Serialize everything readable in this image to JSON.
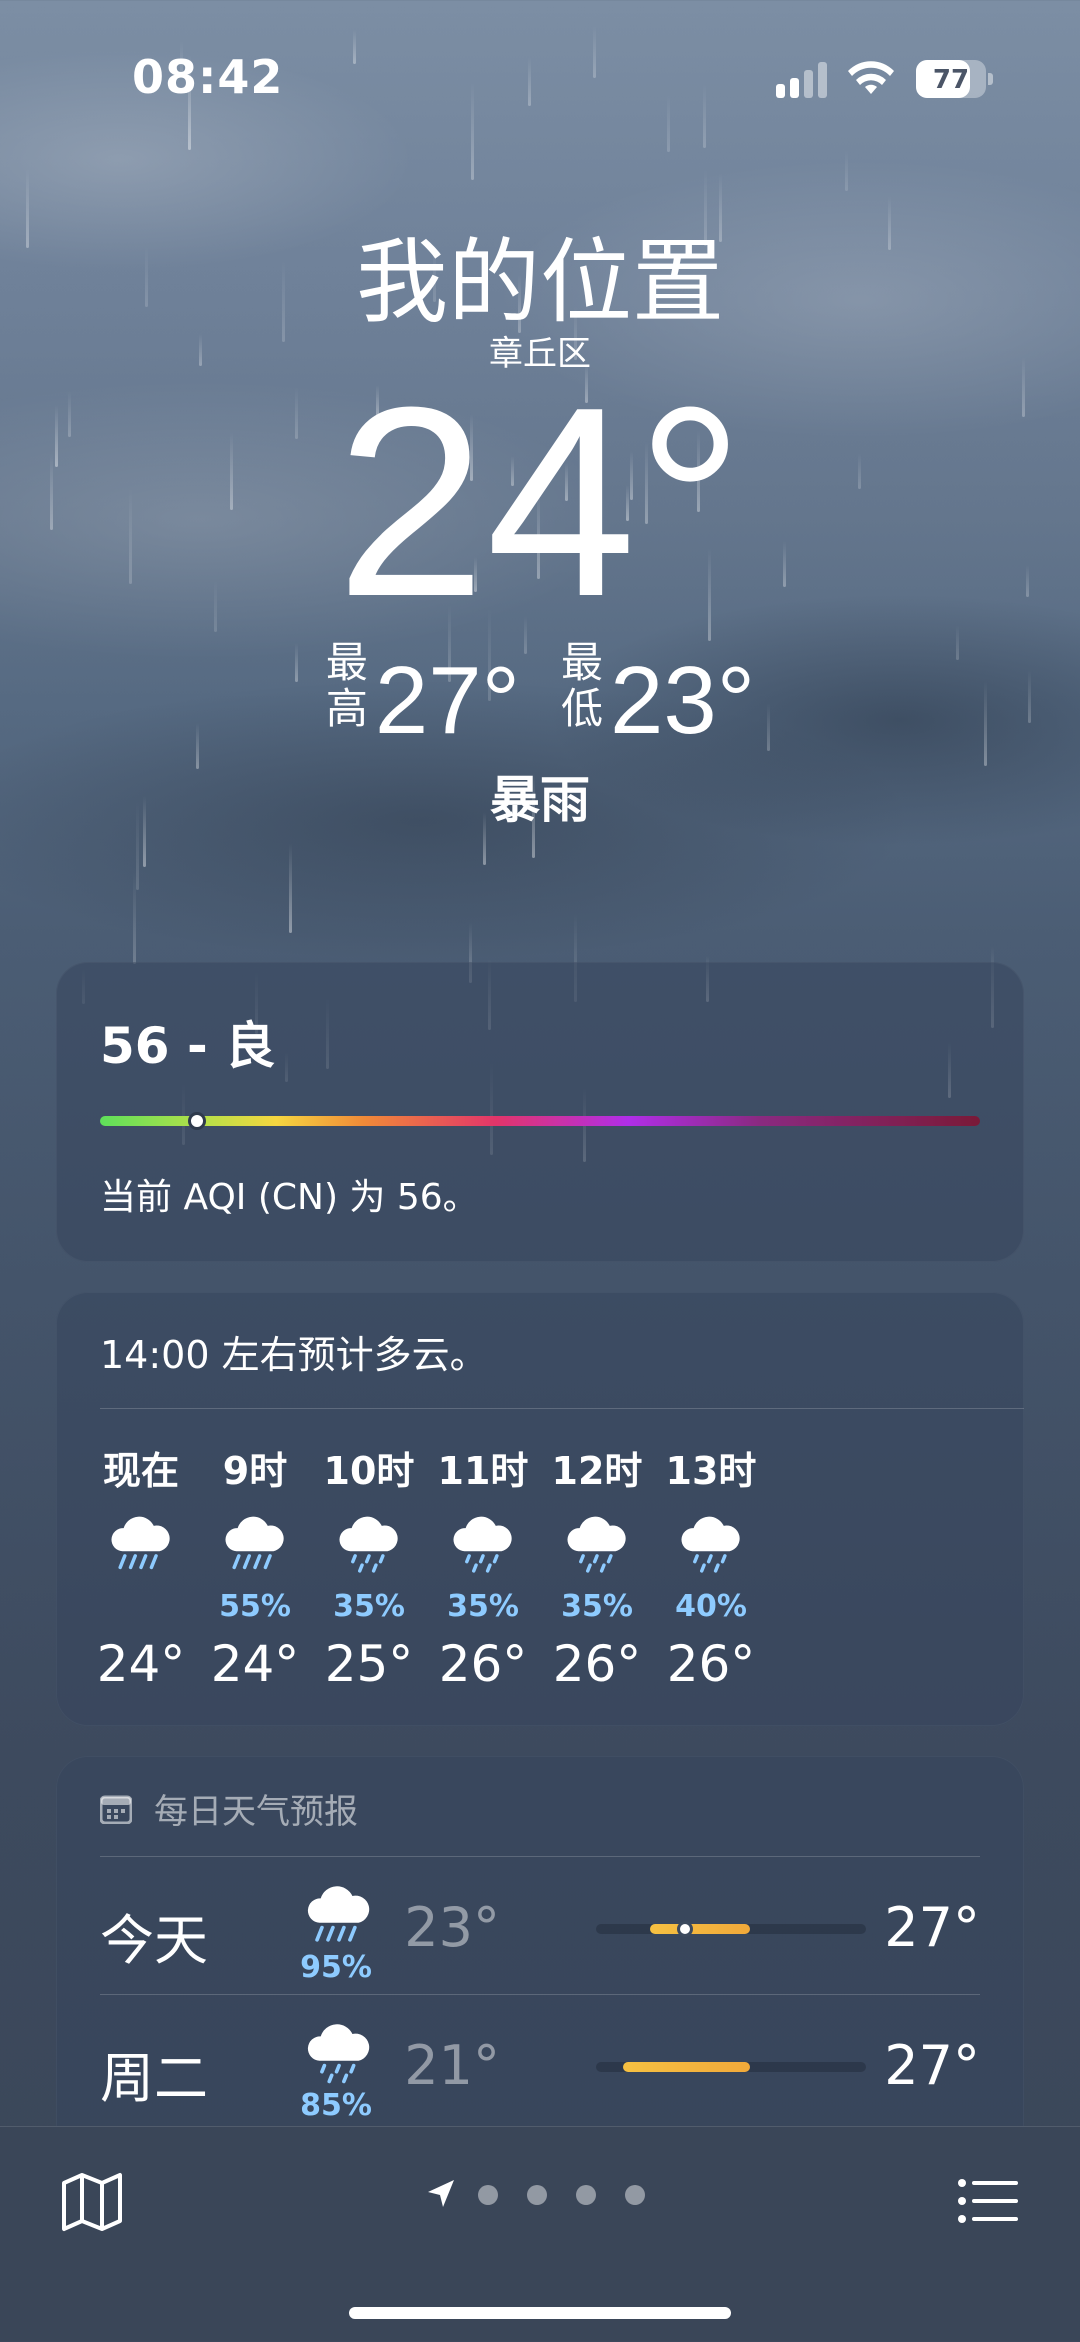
{
  "status_bar": {
    "time": "08:42",
    "battery": "77"
  },
  "location": {
    "title": "我的位置",
    "district": "章丘区"
  },
  "current": {
    "temperature": "24°",
    "high_label": "最\n高",
    "high": "27°",
    "low_label": "最\n低",
    "low": "23°",
    "condition": "暴雨"
  },
  "aqi": {
    "value_label": "56 - 良",
    "description": "当前 AQI (CN) 为 56。",
    "level_fraction": 0.11
  },
  "hourly": {
    "summary": "14:00 左右预计多云。",
    "items": [
      {
        "hour": "现在",
        "icon": "heavy-rain-icon",
        "precip": "",
        "temp": "24°"
      },
      {
        "hour": "9时",
        "icon": "heavy-rain-icon",
        "precip": "55%",
        "temp": "24°"
      },
      {
        "hour": "10时",
        "icon": "rain-icon",
        "precip": "35%",
        "temp": "25°"
      },
      {
        "hour": "11时",
        "icon": "rain-icon",
        "precip": "35%",
        "temp": "26°"
      },
      {
        "hour": "12时",
        "icon": "rain-icon",
        "precip": "35%",
        "temp": "26°"
      },
      {
        "hour": "13时",
        "icon": "rain-icon",
        "precip": "40%",
        "temp": "26°"
      }
    ]
  },
  "daily": {
    "header": "每日天气预报",
    "days": [
      {
        "day": "今天",
        "icon": "heavy-rain-icon",
        "precip": "95%",
        "low": "23°",
        "high": "27°",
        "range_start": 0.2,
        "range_end": 0.57,
        "current": 0.33
      },
      {
        "day": "周二",
        "icon": "rain-icon",
        "precip": "85%",
        "low": "21°",
        "high": "27°",
        "range_start": 0.1,
        "range_end": 0.57
      }
    ]
  },
  "page_dots": {
    "count": 4
  },
  "colors": {
    "precip_blue": "#8ecbff",
    "temp_bar": "#f6c142"
  }
}
